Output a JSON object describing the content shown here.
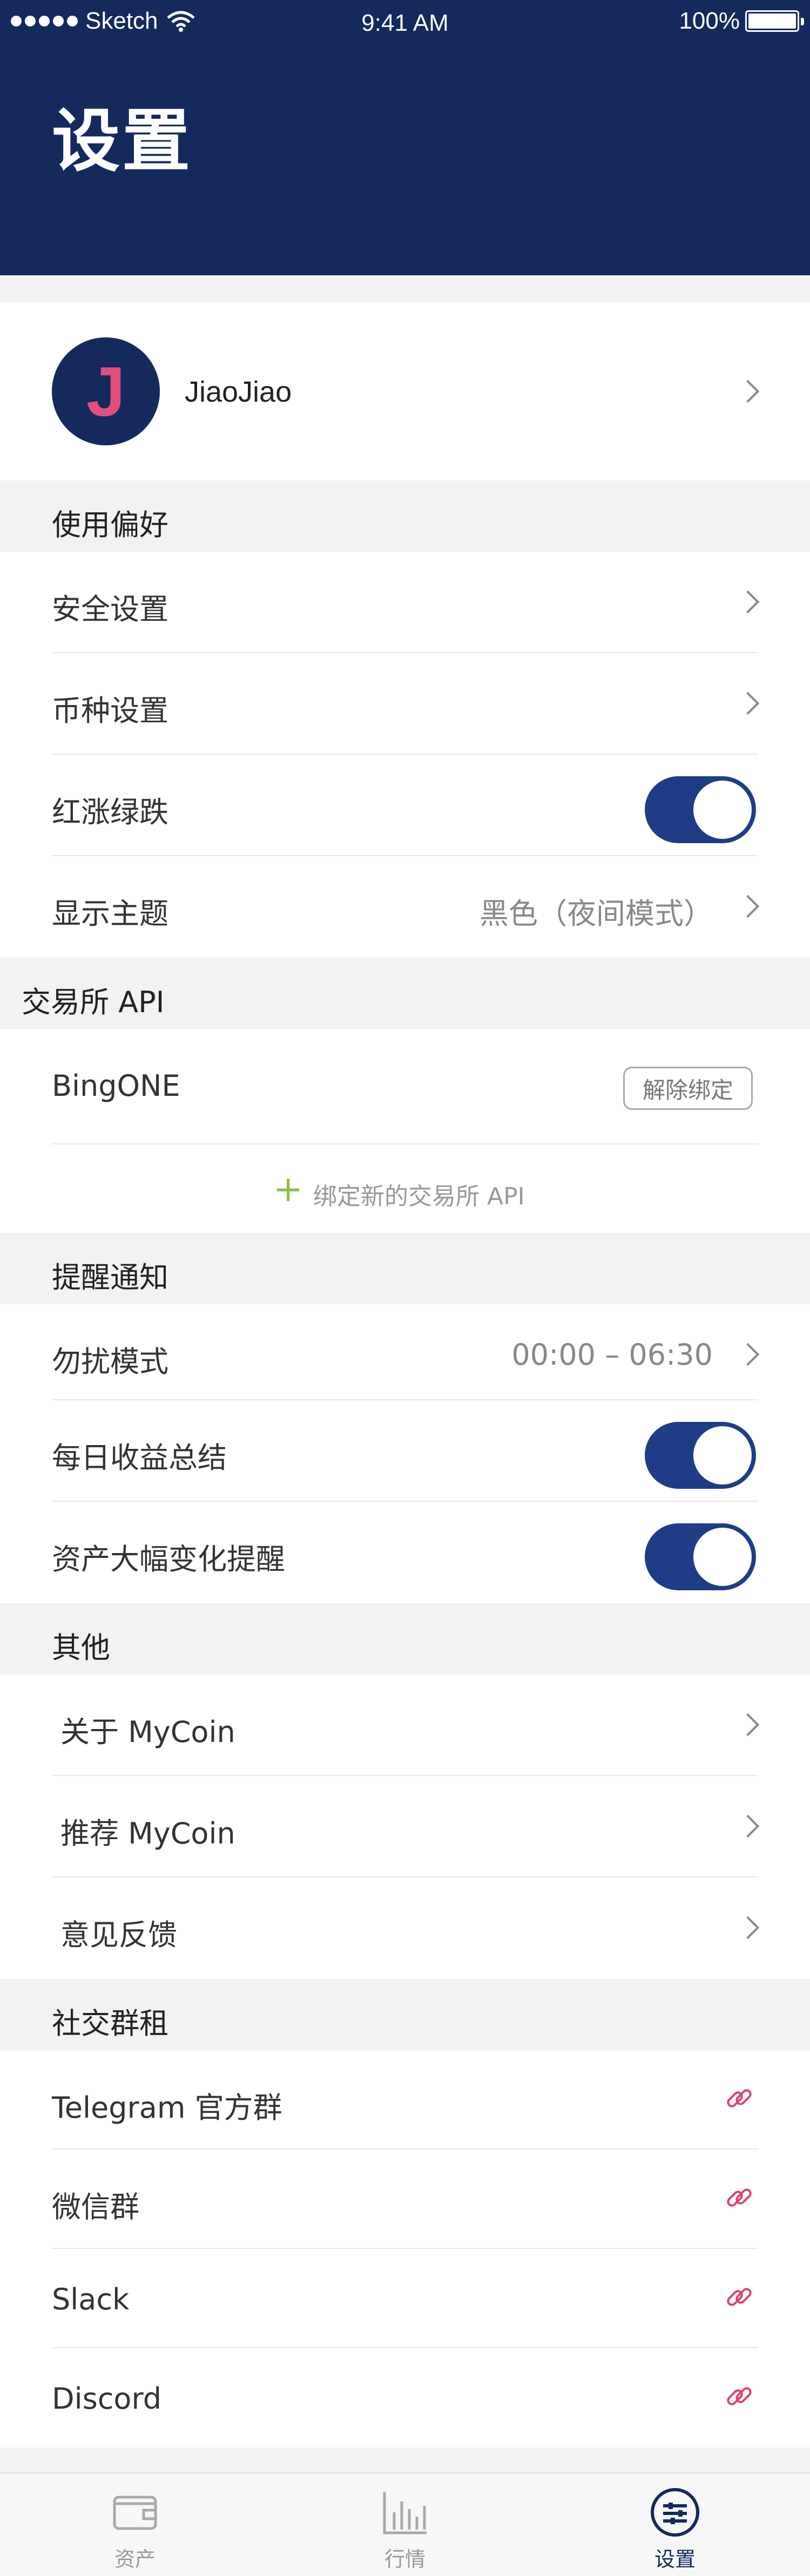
{
  "status_bar": {
    "carrier": "Sketch",
    "time": "9:41 AM",
    "battery": "100%"
  },
  "header": {
    "title": "设置"
  },
  "profile": {
    "avatar_initial": "J",
    "name": "JiaoJiao"
  },
  "sections": {
    "preferences": {
      "title": "使用偏好",
      "security": "安全设置",
      "currency": "币种设置",
      "red_up_green_down": "红涨绿跌",
      "theme_label": "显示主题",
      "theme_value": "黑色（夜间模式）"
    },
    "exchange_api": {
      "title": "交易所 API",
      "exchange_name": "BingONE",
      "unbind_button": "解除绑定",
      "add_api": "绑定新的交易所 API"
    },
    "notifications": {
      "title": "提醒通知",
      "dnd_label": "勿扰模式",
      "dnd_value": "00:00 – 06:30",
      "daily_summary": "每日收益总结",
      "asset_change_alert": "资产大幅变化提醒"
    },
    "other": {
      "title": "其他",
      "about": "关于 MyCoin",
      "recommend": "推荐 MyCoin",
      "feedback": "意见反馈"
    },
    "social": {
      "title": "社交群租",
      "telegram": "Telegram 官方群",
      "wechat": "微信群",
      "slack": "Slack",
      "discord": "Discord"
    }
  },
  "tabbar": {
    "assets": "资产",
    "market": "行情",
    "settings": "设置"
  },
  "toggles": {
    "red_up_green_down": true,
    "daily_summary": true,
    "asset_change_alert": true
  },
  "colors": {
    "brand": "#142a5d",
    "toggle_on": "#1f3d86",
    "avatar_letter": "#e14f7a",
    "link_icon": "#d9436e",
    "add_plus": "#8bc34a"
  }
}
